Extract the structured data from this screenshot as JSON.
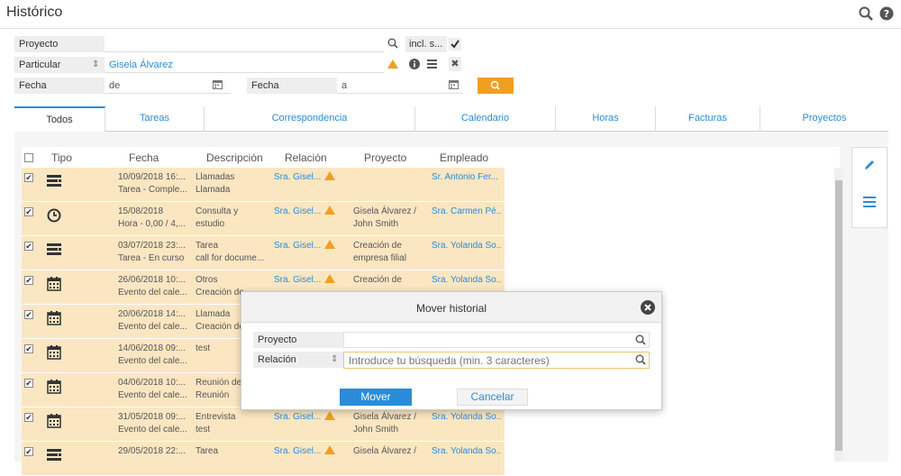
{
  "header": {
    "title": "Histórico"
  },
  "filters": {
    "proyecto_label": "Proyecto",
    "incl_label": "incl. s...",
    "particular_label": "Particular",
    "particular_value": "Gisela Álvarez",
    "fecha_label": "Fecha",
    "de_value": "de",
    "fecha2_label": "Fecha",
    "a_value": "a"
  },
  "tabs": [
    "Todos",
    "Tareas",
    "Correspondencia",
    "Calendario",
    "Horas",
    "Facturas",
    "Proyectos"
  ],
  "columns": [
    "Tipo",
    "Fecha",
    "Descripción",
    "Relación",
    "Proyecto",
    "Empleado"
  ],
  "rows": [
    {
      "icon": "task-icon",
      "fecha1": "10/09/2018 16:...",
      "fecha2": "Tarea - Comple...",
      "desc1": "Llamadas",
      "desc2": "Llamada",
      "rel": "Sra. Gisel...",
      "proj1": "",
      "proj2": "",
      "emp": "Sr. Antonio Fer..."
    },
    {
      "icon": "clock-icon",
      "fecha1": "15/08/2018",
      "fecha2": "Hora - 0,00 / 4,...",
      "desc1": "Consulta y",
      "desc2": "estudio",
      "rel": "Sra. Gisel...",
      "proj1": "Gisela Álvarez /",
      "proj2": "John Smith",
      "emp": "Sra. Carmen Pé..."
    },
    {
      "icon": "task-icon",
      "fecha1": "03/07/2018 23:...",
      "fecha2": "Tarea - En curso",
      "desc1": "Tarea",
      "desc2": "call for docume...",
      "rel": "Sra. Gisel...",
      "proj1": "Creación de",
      "proj2": "empresa filial",
      "emp": "Sra. Yolanda So..."
    },
    {
      "icon": "calendar-icon",
      "fecha1": "26/06/2018 10:...",
      "fecha2": "Evento del cale...",
      "desc1": "Otros",
      "desc2": "Creación de",
      "rel": "Sra. Gisel...",
      "proj1": "Creación de",
      "proj2": "",
      "emp": "Sra. Yolanda So..."
    },
    {
      "icon": "calendar-icon",
      "fecha1": "20/06/2018 14:...",
      "fecha2": "Evento del cale...",
      "desc1": "Llamada",
      "desc2": "Creación de",
      "rel": "",
      "proj1": "",
      "proj2": "",
      "emp": ""
    },
    {
      "icon": "calendar-icon",
      "fecha1": "14/06/2018 09:...",
      "fecha2": "Evento del cale...",
      "desc1": "test",
      "desc2": "",
      "rel": "",
      "proj1": "",
      "proj2": "",
      "emp": ""
    },
    {
      "icon": "calendar-icon",
      "fecha1": "04/06/2018 10:...",
      "fecha2": "Evento del cale...",
      "desc1": "Reunión de",
      "desc2": "Reunión",
      "rel": "",
      "proj1": "",
      "proj2": "",
      "emp": ""
    },
    {
      "icon": "calendar-icon",
      "fecha1": "31/05/2018 09:...",
      "fecha2": "Evento del cale...",
      "desc1": "Entrevista",
      "desc2": "test",
      "rel": "Sra. Gisel...",
      "proj1": "Gisela Álvarez /",
      "proj2": "John Smith",
      "emp": "Sra. Yolanda So..."
    },
    {
      "icon": "task-icon",
      "fecha1": "29/05/2018 22:...",
      "fecha2": "",
      "desc1": "Tarea",
      "desc2": "",
      "rel": "Sra. Gisel...",
      "proj1": "Gisela Álvarez /",
      "proj2": "",
      "emp": "Sra. Yolanda So..."
    }
  ],
  "modal": {
    "title": "Mover historial",
    "proyecto_label": "Proyecto",
    "relacion_label": "Relación",
    "relacion_placeholder": "Introduce tu búsqueda (min. 3 caracteres)",
    "move_label": "Mover",
    "cancel_label": "Cancelar"
  },
  "colors": {
    "accent": "#2a8cd8",
    "row": "#fbe6c2",
    "search": "#f0a020"
  }
}
